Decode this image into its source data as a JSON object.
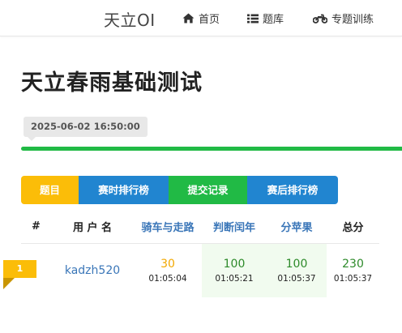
{
  "nav": {
    "brand": "天立OI",
    "items": [
      {
        "label": "首页",
        "icon": "home-icon"
      },
      {
        "label": "题库",
        "icon": "list-icon"
      },
      {
        "label": "专题训练",
        "icon": "motorcycle-icon"
      }
    ]
  },
  "contest": {
    "title": "天立春雨基础测试",
    "time_label": "2025-06-02 16:50:00",
    "progress": 1.0
  },
  "tabs": [
    {
      "label": "题目",
      "color": "#fbbd08"
    },
    {
      "label": "赛时排行榜",
      "color": "#2185d0"
    },
    {
      "label": "提交记录",
      "color": "#21ba45"
    },
    {
      "label": "赛后排行榜",
      "color": "#2185d0"
    }
  ],
  "table": {
    "headers": {
      "rank": "#",
      "user": "用 户 名",
      "problems": [
        "骑车与走路",
        "判断闰年",
        "分苹果"
      ],
      "total": "总分"
    },
    "rows": [
      {
        "rank": "1",
        "user": "kadzh520",
        "cells": [
          {
            "score": "30",
            "time": "01:05:04",
            "status": "partial"
          },
          {
            "score": "100",
            "time": "01:05:21",
            "status": "full"
          },
          {
            "score": "100",
            "time": "01:05:37",
            "status": "full"
          }
        ],
        "total": "230",
        "total_time": "01:05:37"
      }
    ]
  },
  "colors": {
    "accent_yellow": "#fbbd08",
    "accent_blue": "#2185d0",
    "accent_green": "#21ba45",
    "link_blue": "#3a76b8"
  }
}
